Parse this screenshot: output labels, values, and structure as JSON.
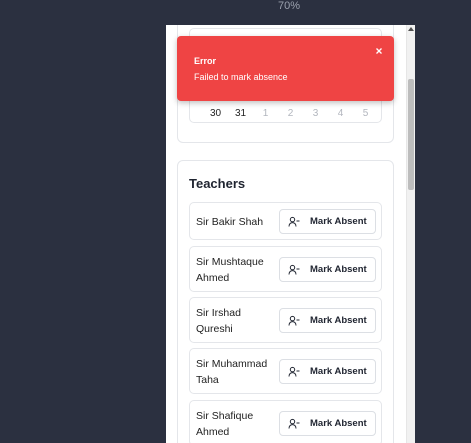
{
  "browser": {
    "zoom": "70%"
  },
  "calendar": {
    "days": [
      {
        "label": "30",
        "muted": false
      },
      {
        "label": "31",
        "muted": false
      },
      {
        "label": "1",
        "muted": true
      },
      {
        "label": "2",
        "muted": true
      },
      {
        "label": "3",
        "muted": true
      },
      {
        "label": "4",
        "muted": true
      },
      {
        "label": "5",
        "muted": true
      }
    ]
  },
  "teachers": {
    "title": "Teachers",
    "button_label": "Mark Absent",
    "items": [
      {
        "name": "Sir Bakir Shah"
      },
      {
        "name": "Sir Mushtaque Ahmed"
      },
      {
        "name": "Sir Irshad Qureshi"
      },
      {
        "name": "Sir Muhammad Taha"
      },
      {
        "name": "Sir Shafique Ahmed"
      }
    ]
  },
  "toast": {
    "title": "Error",
    "message": "Failed to mark absence",
    "color": "#ef4444"
  }
}
